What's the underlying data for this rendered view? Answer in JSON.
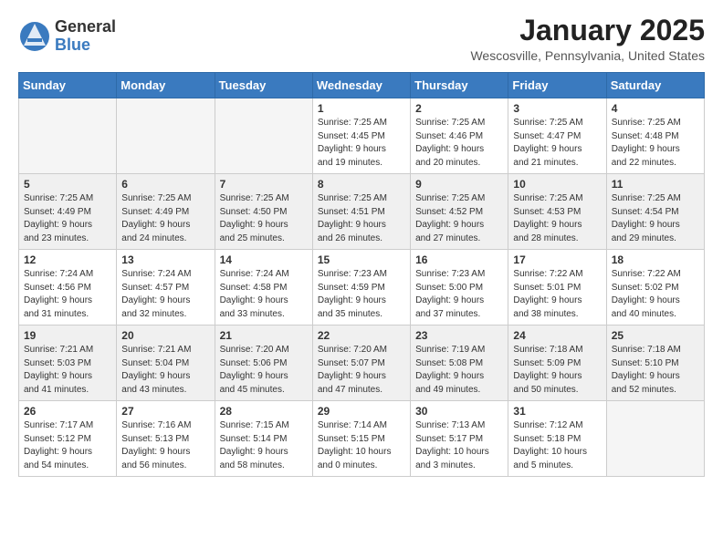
{
  "header": {
    "logo_general": "General",
    "logo_blue": "Blue",
    "month_year": "January 2025",
    "location": "Wescosville, Pennsylvania, United States"
  },
  "weekdays": [
    "Sunday",
    "Monday",
    "Tuesday",
    "Wednesday",
    "Thursday",
    "Friday",
    "Saturday"
  ],
  "weeks": [
    [
      {
        "day": "",
        "info": ""
      },
      {
        "day": "",
        "info": ""
      },
      {
        "day": "",
        "info": ""
      },
      {
        "day": "1",
        "info": "Sunrise: 7:25 AM\nSunset: 4:45 PM\nDaylight: 9 hours\nand 19 minutes."
      },
      {
        "day": "2",
        "info": "Sunrise: 7:25 AM\nSunset: 4:46 PM\nDaylight: 9 hours\nand 20 minutes."
      },
      {
        "day": "3",
        "info": "Sunrise: 7:25 AM\nSunset: 4:47 PM\nDaylight: 9 hours\nand 21 minutes."
      },
      {
        "day": "4",
        "info": "Sunrise: 7:25 AM\nSunset: 4:48 PM\nDaylight: 9 hours\nand 22 minutes."
      }
    ],
    [
      {
        "day": "5",
        "info": "Sunrise: 7:25 AM\nSunset: 4:49 PM\nDaylight: 9 hours\nand 23 minutes."
      },
      {
        "day": "6",
        "info": "Sunrise: 7:25 AM\nSunset: 4:49 PM\nDaylight: 9 hours\nand 24 minutes."
      },
      {
        "day": "7",
        "info": "Sunrise: 7:25 AM\nSunset: 4:50 PM\nDaylight: 9 hours\nand 25 minutes."
      },
      {
        "day": "8",
        "info": "Sunrise: 7:25 AM\nSunset: 4:51 PM\nDaylight: 9 hours\nand 26 minutes."
      },
      {
        "day": "9",
        "info": "Sunrise: 7:25 AM\nSunset: 4:52 PM\nDaylight: 9 hours\nand 27 minutes."
      },
      {
        "day": "10",
        "info": "Sunrise: 7:25 AM\nSunset: 4:53 PM\nDaylight: 9 hours\nand 28 minutes."
      },
      {
        "day": "11",
        "info": "Sunrise: 7:25 AM\nSunset: 4:54 PM\nDaylight: 9 hours\nand 29 minutes."
      }
    ],
    [
      {
        "day": "12",
        "info": "Sunrise: 7:24 AM\nSunset: 4:56 PM\nDaylight: 9 hours\nand 31 minutes."
      },
      {
        "day": "13",
        "info": "Sunrise: 7:24 AM\nSunset: 4:57 PM\nDaylight: 9 hours\nand 32 minutes."
      },
      {
        "day": "14",
        "info": "Sunrise: 7:24 AM\nSunset: 4:58 PM\nDaylight: 9 hours\nand 33 minutes."
      },
      {
        "day": "15",
        "info": "Sunrise: 7:23 AM\nSunset: 4:59 PM\nDaylight: 9 hours\nand 35 minutes."
      },
      {
        "day": "16",
        "info": "Sunrise: 7:23 AM\nSunset: 5:00 PM\nDaylight: 9 hours\nand 37 minutes."
      },
      {
        "day": "17",
        "info": "Sunrise: 7:22 AM\nSunset: 5:01 PM\nDaylight: 9 hours\nand 38 minutes."
      },
      {
        "day": "18",
        "info": "Sunrise: 7:22 AM\nSunset: 5:02 PM\nDaylight: 9 hours\nand 40 minutes."
      }
    ],
    [
      {
        "day": "19",
        "info": "Sunrise: 7:21 AM\nSunset: 5:03 PM\nDaylight: 9 hours\nand 41 minutes."
      },
      {
        "day": "20",
        "info": "Sunrise: 7:21 AM\nSunset: 5:04 PM\nDaylight: 9 hours\nand 43 minutes."
      },
      {
        "day": "21",
        "info": "Sunrise: 7:20 AM\nSunset: 5:06 PM\nDaylight: 9 hours\nand 45 minutes."
      },
      {
        "day": "22",
        "info": "Sunrise: 7:20 AM\nSunset: 5:07 PM\nDaylight: 9 hours\nand 47 minutes."
      },
      {
        "day": "23",
        "info": "Sunrise: 7:19 AM\nSunset: 5:08 PM\nDaylight: 9 hours\nand 49 minutes."
      },
      {
        "day": "24",
        "info": "Sunrise: 7:18 AM\nSunset: 5:09 PM\nDaylight: 9 hours\nand 50 minutes."
      },
      {
        "day": "25",
        "info": "Sunrise: 7:18 AM\nSunset: 5:10 PM\nDaylight: 9 hours\nand 52 minutes."
      }
    ],
    [
      {
        "day": "26",
        "info": "Sunrise: 7:17 AM\nSunset: 5:12 PM\nDaylight: 9 hours\nand 54 minutes."
      },
      {
        "day": "27",
        "info": "Sunrise: 7:16 AM\nSunset: 5:13 PM\nDaylight: 9 hours\nand 56 minutes."
      },
      {
        "day": "28",
        "info": "Sunrise: 7:15 AM\nSunset: 5:14 PM\nDaylight: 9 hours\nand 58 minutes."
      },
      {
        "day": "29",
        "info": "Sunrise: 7:14 AM\nSunset: 5:15 PM\nDaylight: 10 hours\nand 0 minutes."
      },
      {
        "day": "30",
        "info": "Sunrise: 7:13 AM\nSunset: 5:17 PM\nDaylight: 10 hours\nand 3 minutes."
      },
      {
        "day": "31",
        "info": "Sunrise: 7:12 AM\nSunset: 5:18 PM\nDaylight: 10 hours\nand 5 minutes."
      },
      {
        "day": "",
        "info": ""
      }
    ]
  ]
}
